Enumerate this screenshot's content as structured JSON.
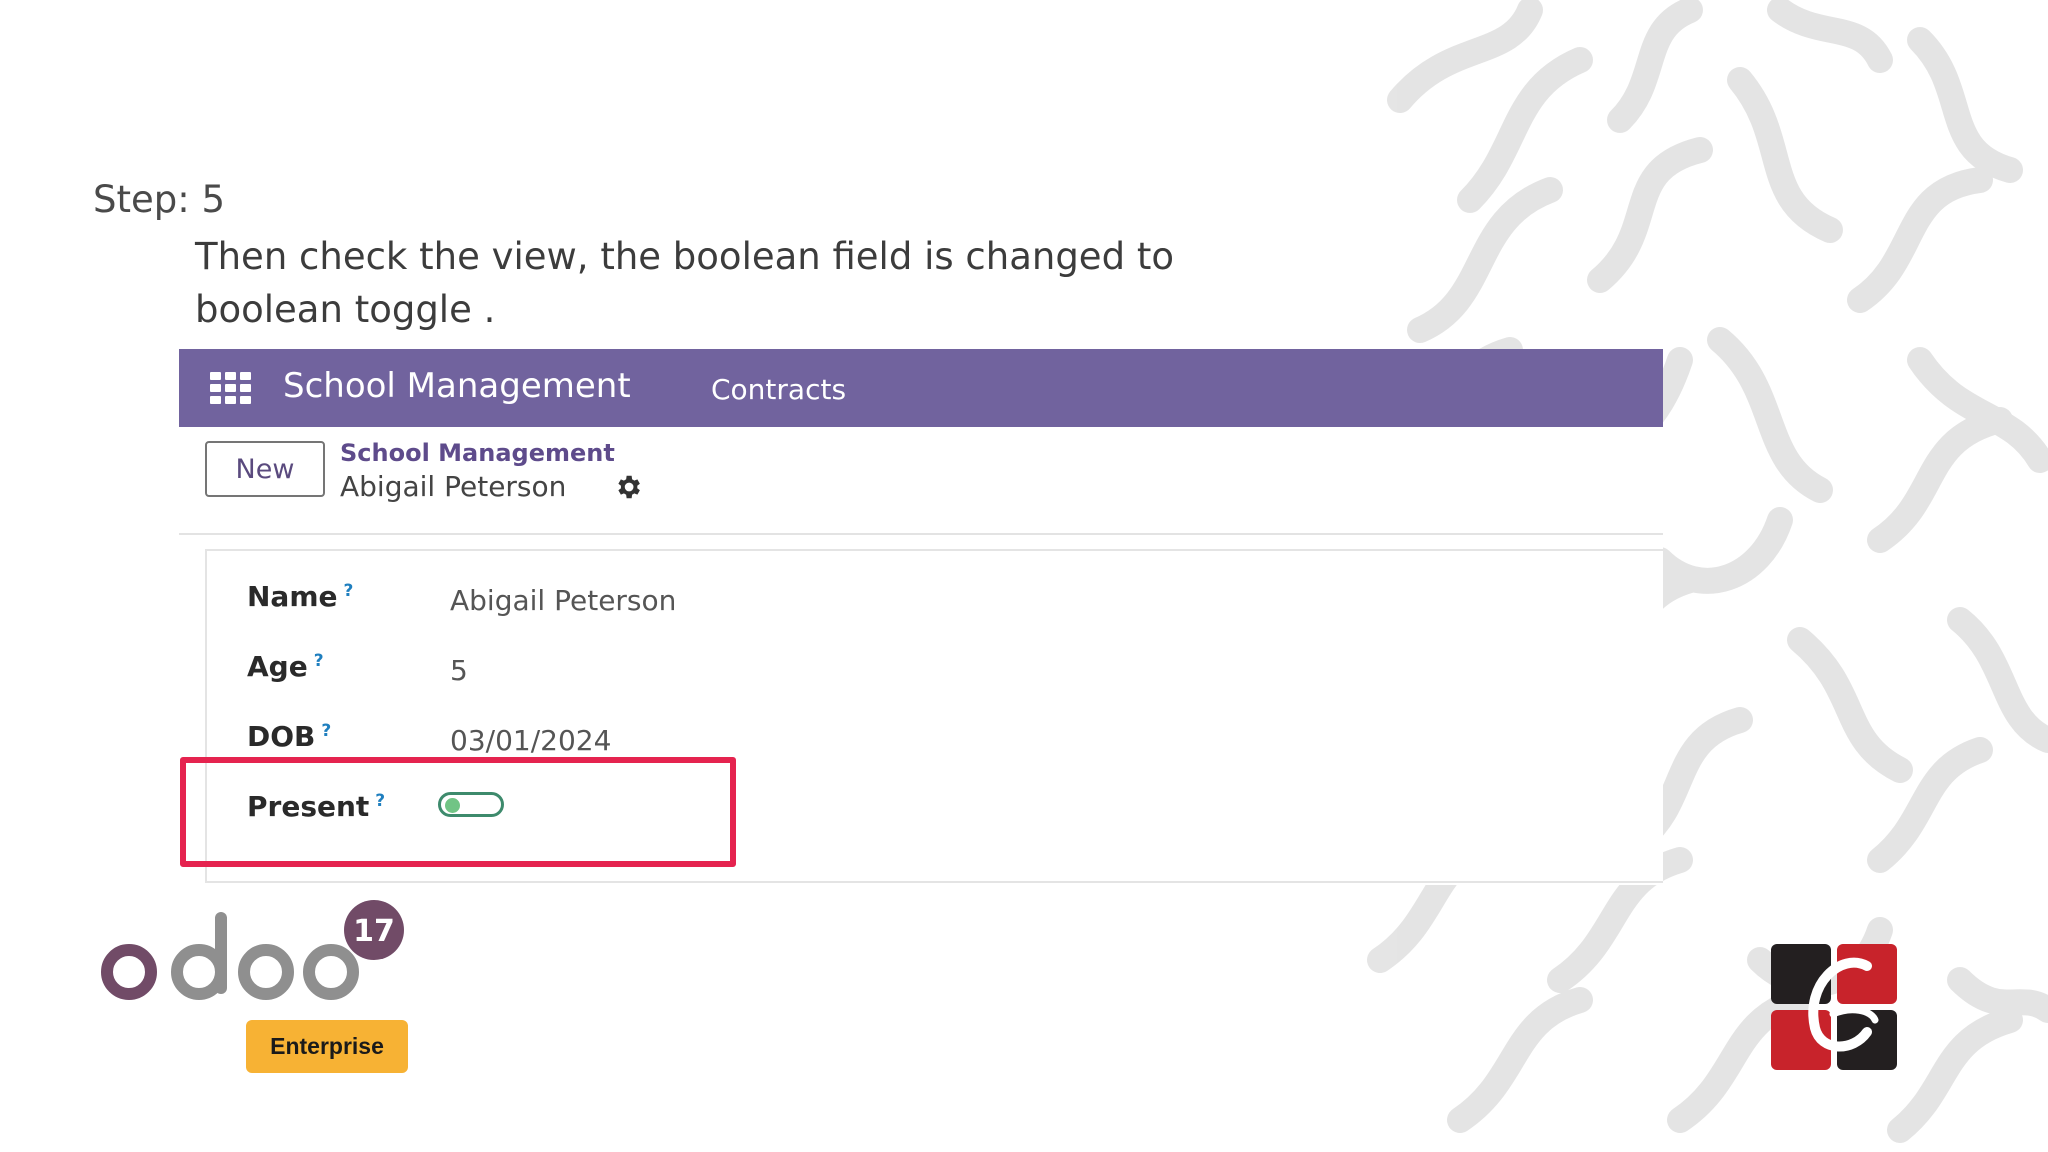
{
  "slide": {
    "step_title": "Step: 5",
    "step_description": "Then check the view, the boolean field is changed to boolean toggle ."
  },
  "navbar": {
    "brand": "School Management",
    "menu_items": [
      "Contracts"
    ],
    "background_color": "#71639e"
  },
  "control_panel": {
    "new_button": "New",
    "breadcrumb_parent": "School Management",
    "breadcrumb_current": "Abigail Peterson"
  },
  "form": {
    "help_mark": "?",
    "fields": [
      {
        "label": "Name",
        "value": "Abigail Peterson"
      },
      {
        "label": "Age",
        "value": "5"
      },
      {
        "label": "DOB",
        "value": "03/01/2024"
      },
      {
        "label": "Present",
        "widget": "boolean_toggle",
        "checked": false
      }
    ],
    "highlight_color": "#e5234f"
  },
  "branding": {
    "odoo_version_badge": "17",
    "odoo_wordmark": "odoo",
    "odoo_edition": "Enterprise",
    "partner_logo_letters": "C"
  }
}
